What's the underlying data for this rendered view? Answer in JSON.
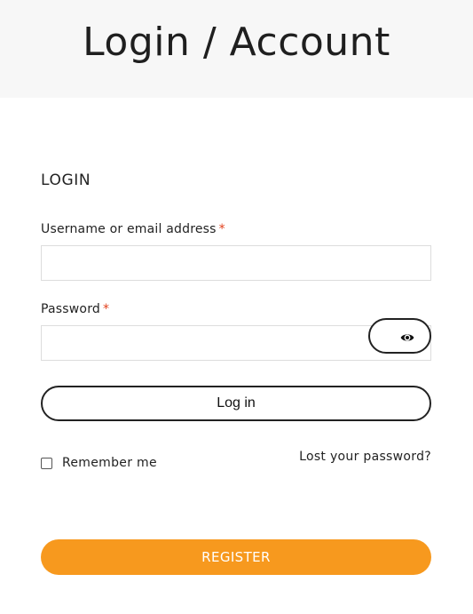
{
  "header": {
    "title": "Login / Account"
  },
  "login": {
    "heading": "LOGIN",
    "username_label": "Username or email address",
    "username_value": "",
    "password_label": "Password",
    "password_value": "",
    "required_mark": "*",
    "password_toggle_icon": "eye-icon",
    "login_button_label": "Log in",
    "remember_label": "Remember me",
    "remember_checked": false,
    "lost_password_label": "Lost your password?"
  },
  "register": {
    "button_label": "REGISTER"
  },
  "colors": {
    "accent": "#f7991e",
    "required": "#e2401c",
    "header_bg": "#f7f7f7"
  }
}
